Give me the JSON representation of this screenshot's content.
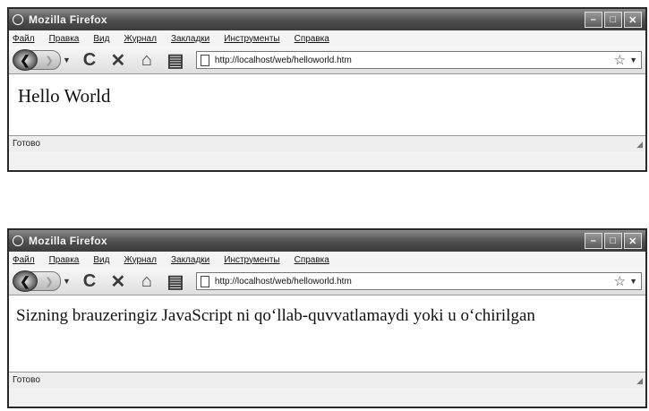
{
  "window": {
    "title": "Mozilla Firefox",
    "controls": [
      "–",
      "□",
      "✕"
    ]
  },
  "menu": {
    "items": [
      "Файл",
      "Правка",
      "Вид",
      "Журнал",
      "Закладки",
      "Инструменты",
      "Справка"
    ]
  },
  "navigation": {
    "url": "http://localhost/web/helloworld.htm"
  },
  "status": {
    "text": "Готово"
  },
  "pages": [
    {
      "content": "Hello World"
    },
    {
      "content": "Sizning brauzeringiz JavaScript ni qo‘llab-quvvatlamaydi yoki u o‘chirilgan"
    }
  ],
  "icons": {
    "back": "back-arrow-icon",
    "forward": "forward-arrow-icon",
    "reload": "reload-icon",
    "stop": "stop-icon",
    "home": "home-icon",
    "bookmark": "star-icon"
  }
}
